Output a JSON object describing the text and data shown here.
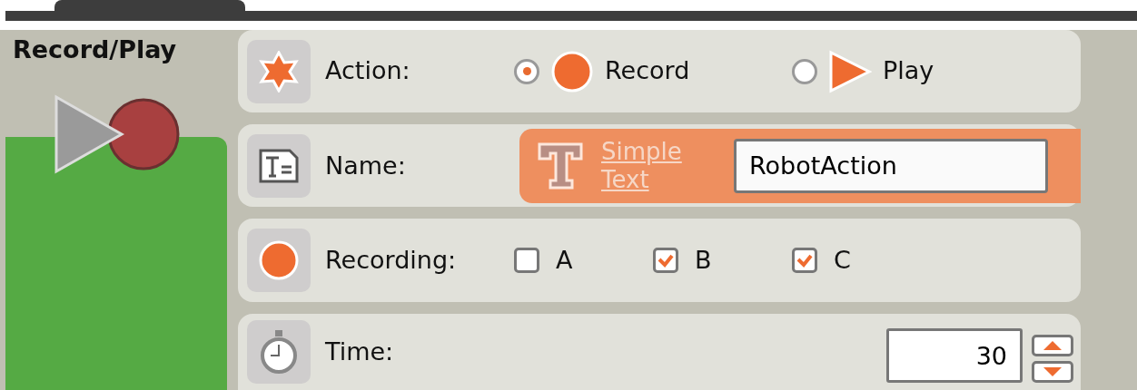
{
  "block": {
    "title": "Record/Play"
  },
  "action": {
    "label": "Action:",
    "options": [
      {
        "label": "Record",
        "kind": "record",
        "selected": true
      },
      {
        "label": "Play",
        "kind": "play",
        "selected": false
      }
    ]
  },
  "name": {
    "label": "Name:",
    "type_label": "Simple Text",
    "value": "RobotAction"
  },
  "recording": {
    "label": "Recording:",
    "ports": [
      {
        "label": "A",
        "checked": false
      },
      {
        "label": "B",
        "checked": true
      },
      {
        "label": "C",
        "checked": true
      }
    ]
  },
  "time": {
    "label": "Time:",
    "value": "30"
  }
}
